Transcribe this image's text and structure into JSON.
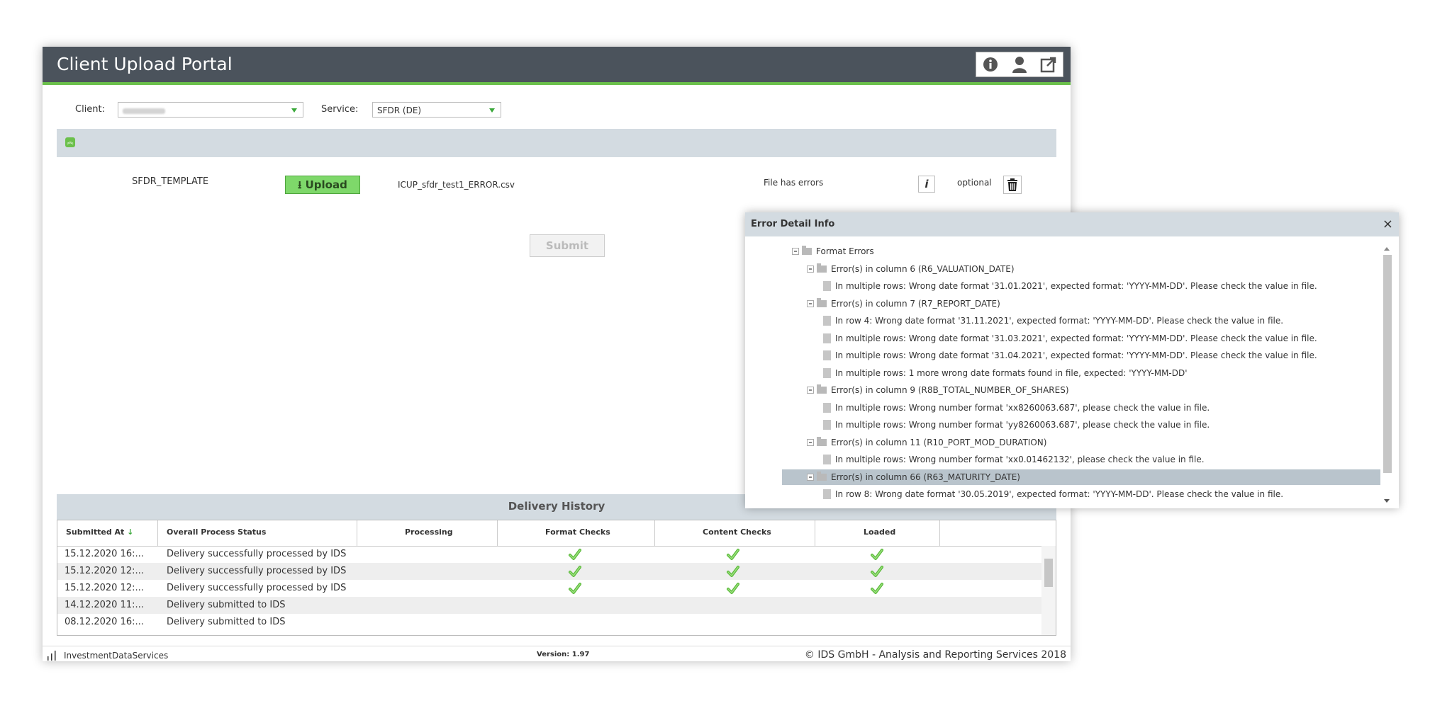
{
  "app": {
    "title": "Client Upload Portal",
    "header_icons": [
      "info-icon",
      "user-icon",
      "external-link-icon"
    ]
  },
  "filters": {
    "client_label": "Client:",
    "client_value": "",
    "service_label": "Service:",
    "service_value": "SFDR (DE)"
  },
  "upload_row": {
    "template": "SFDR_TEMPLATE",
    "upload_label": "Upload",
    "filename": "ICUP_sfdr_test1_ERROR.csv",
    "status": "File has errors",
    "info_label": "i",
    "requirement": "optional"
  },
  "submit_label": "Submit",
  "delivery_history": {
    "title": "Delivery History",
    "columns": [
      "Submitted At",
      "Overall Process Status",
      "Processing",
      "Format Checks",
      "Content Checks",
      "Loaded"
    ],
    "rows": [
      {
        "submitted": "15.12.2020 16:...",
        "status": "Delivery successfully processed by IDS",
        "format": true,
        "content": true,
        "loaded": true
      },
      {
        "submitted": "15.12.2020 12:...",
        "status": "Delivery successfully processed by IDS",
        "format": true,
        "content": true,
        "loaded": true
      },
      {
        "submitted": "15.12.2020 12:...",
        "status": "Delivery successfully processed by IDS",
        "format": true,
        "content": true,
        "loaded": true
      },
      {
        "submitted": "14.12.2020 11:...",
        "status": "Delivery submitted to IDS",
        "format": false,
        "content": false,
        "loaded": false
      },
      {
        "submitted": "08.12.2020 16:...",
        "status": "Delivery submitted to IDS",
        "format": false,
        "content": false,
        "loaded": false
      }
    ]
  },
  "footer": {
    "logo": "InvestmentDataServices",
    "version": "Version: 1.97",
    "copyright": "© IDS GmbH - Analysis and Reporting Services 2018"
  },
  "error_dialog": {
    "title": "Error Detail Info",
    "close": "×",
    "tree": [
      {
        "level": 0,
        "kind": "folder",
        "text": "Format Errors"
      },
      {
        "level": 1,
        "kind": "folder",
        "text": "Error(s) in column 6 (R6_VALUATION_DATE)"
      },
      {
        "level": 2,
        "kind": "doc",
        "text": "In multiple rows: Wrong date format '31.01.2021', expected format: 'YYYY-MM-DD'. Please check the value in file."
      },
      {
        "level": 1,
        "kind": "folder",
        "text": "Error(s) in column 7 (R7_REPORT_DATE)"
      },
      {
        "level": 2,
        "kind": "doc",
        "text": "In row 4: Wrong date format '31.11.2021', expected format: 'YYYY-MM-DD'. Please check the value in file."
      },
      {
        "level": 2,
        "kind": "doc",
        "text": "In multiple rows: Wrong date format '31.03.2021', expected format: 'YYYY-MM-DD'. Please check the value in file."
      },
      {
        "level": 2,
        "kind": "doc",
        "text": "In multiple rows: Wrong date format '31.04.2021', expected format: 'YYYY-MM-DD'. Please check the value in file."
      },
      {
        "level": 2,
        "kind": "doc",
        "text": "In multiple rows: 1 more wrong date formats found in file, expected: 'YYYY-MM-DD'"
      },
      {
        "level": 1,
        "kind": "folder",
        "text": "Error(s) in column 9 (R8B_TOTAL_NUMBER_OF_SHARES)"
      },
      {
        "level": 2,
        "kind": "doc",
        "text": "In multiple rows: Wrong number format 'xx8260063.687', please check the value in file."
      },
      {
        "level": 2,
        "kind": "doc",
        "text": "In multiple rows: Wrong number format 'yy8260063.687', please check the value in file."
      },
      {
        "level": 1,
        "kind": "folder",
        "text": "Error(s) in column 11 (R10_PORT_MOD_DURATION)"
      },
      {
        "level": 2,
        "kind": "doc",
        "text": "In multiple rows: Wrong number format 'xx0.01462132', please check the value in file."
      },
      {
        "level": 1,
        "kind": "folder",
        "text": "Error(s) in column 66 (R63_MATURITY_DATE)",
        "selected": true
      },
      {
        "level": 2,
        "kind": "doc",
        "text": "In row 8: Wrong date format '30.05.2019', expected format: 'YYYY-MM-DD'. Please check the value in file."
      }
    ]
  },
  "colors": {
    "header_bg": "#4b535c",
    "accent_green": "#6bc04b",
    "panel_bg": "#d3dbe1"
  }
}
